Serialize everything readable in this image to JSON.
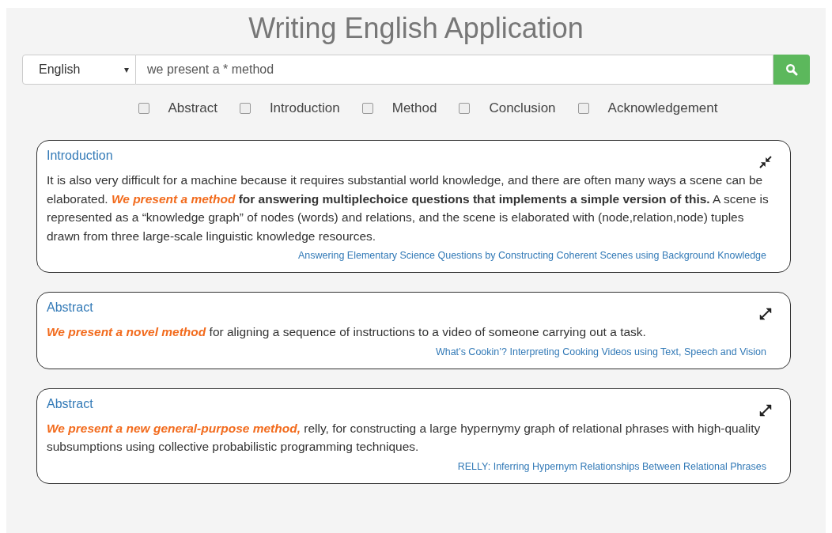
{
  "title": "Writing English Application",
  "language_select": {
    "value": "English",
    "arrow": "▾"
  },
  "search": {
    "value": "we present a * method"
  },
  "filters": [
    {
      "label": "Abstract",
      "checked": false
    },
    {
      "label": "Introduction",
      "checked": false
    },
    {
      "label": "Method",
      "checked": false
    },
    {
      "label": "Conclusion",
      "checked": false
    },
    {
      "label": "Acknowledgement",
      "checked": false
    }
  ],
  "results": [
    {
      "section": "Introduction",
      "expanded": true,
      "segments": [
        {
          "kind": "plain",
          "text": "It is also very difficult for a machine because it requires substantial world knowledge, and there are often many ways a scene can be elaborated. "
        },
        {
          "kind": "highlight",
          "text": "We present a method"
        },
        {
          "kind": "bold",
          "text": " for answering multiplechoice questions that implements a simple version of this."
        },
        {
          "kind": "plain",
          "text": " A scene is represented as a “knowledge graph” of nodes (words) and relations, and the scene is elaborated with (node,relation,node) tuples drawn from three large-scale linguistic knowledge resources."
        }
      ],
      "source": "Answering Elementary Science Questions by Constructing Coherent Scenes using Background Knowledge"
    },
    {
      "section": "Abstract",
      "expanded": false,
      "segments": [
        {
          "kind": "highlight",
          "text": "We present a novel method"
        },
        {
          "kind": "plain",
          "text": " for aligning a sequence of instructions to a video of someone carrying out a task."
        }
      ],
      "source": "What’s Cookin’? Interpreting Cooking Videos using Text, Speech and Vision"
    },
    {
      "section": "Abstract",
      "expanded": false,
      "segments": [
        {
          "kind": "highlight",
          "text": "We present a new general-purpose method,"
        },
        {
          "kind": "plain",
          "text": " relly, for constructing a large hypernymy graph of relational phrases with high-quality subsumptions using collective probabilistic programming techniques."
        }
      ],
      "source": "RELLY: Inferring Hypernym Relationships Between Relational Phrases"
    }
  ]
}
